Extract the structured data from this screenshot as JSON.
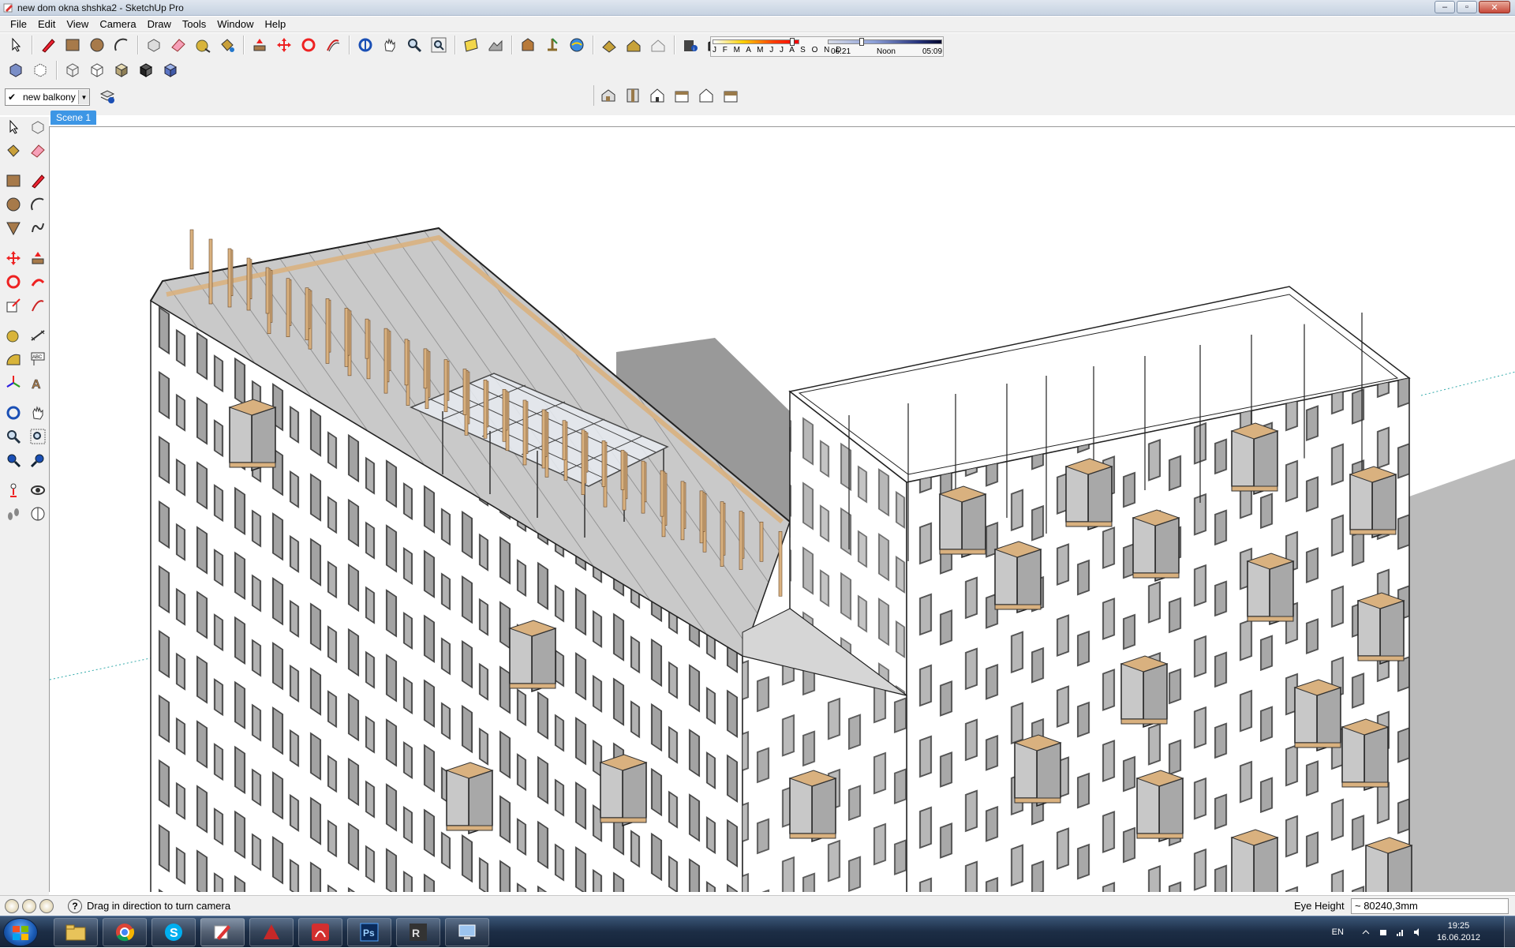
{
  "window": {
    "title": "new dom okna shshka2 - SketchUp Pro",
    "controls": [
      "minimize",
      "maximize",
      "close"
    ]
  },
  "menu": {
    "items": [
      "File",
      "Edit",
      "View",
      "Camera",
      "Draw",
      "Tools",
      "Window",
      "Help"
    ]
  },
  "toolbar": {
    "main_icons": [
      "select-icon",
      "pencil-icon",
      "rectangle-icon",
      "circle-icon",
      "arc-icon",
      "component-icon",
      "eraser-icon",
      "tape-measure-icon",
      "paint-bucket-icon",
      "push-pull-icon",
      "move-icon",
      "rotate-icon",
      "offset-icon",
      "orbit-icon",
      "pan-icon",
      "zoom-icon",
      "zoom-extents-icon",
      "add-location-icon",
      "toggle-terrain-icon",
      "photo-texture-icon",
      "get-models-icon",
      "share-model-icon",
      "share-component-icon",
      "warehouse-icon",
      "shadow-settings-icon",
      "display-shadows-icon"
    ],
    "view_icons": [
      "iso-view-icon",
      "top-view-icon",
      "front-view-icon",
      "right-view-icon",
      "back-view-icon",
      "left-view-icon"
    ],
    "style_icons": [
      "xray-icon",
      "back-edges-icon",
      "wireframe-icon",
      "hidden-line-icon",
      "shaded-icon",
      "shaded-textures-icon",
      "monochrome-icon"
    ]
  },
  "shadows": {
    "months": "J F M A M J J A S O N D",
    "time_start": "06:21",
    "time_mid": "Noon",
    "time_end": "05:09"
  },
  "layer": {
    "current": "new balkony",
    "checked": "✔"
  },
  "scene": {
    "tab": "Scene 1"
  },
  "status": {
    "message": "Drag in direction to turn camera",
    "vcb_label": "Eye Height",
    "vcb_value": "~ 80240,3mm"
  },
  "taskbar": {
    "apps": [
      "explorer-icon",
      "chrome-icon",
      "skype-icon",
      "sketchup-icon",
      "autocad-icon",
      "acrobat-icon",
      "photoshop-icon",
      "vray-icon",
      "network-icon"
    ],
    "lang": "EN",
    "time": "19:25",
    "date": "16.06.2012"
  },
  "colors": {
    "scene_tab": "#3d96e5",
    "wood": "#d9b17f",
    "roof": "#c8c8c8"
  }
}
